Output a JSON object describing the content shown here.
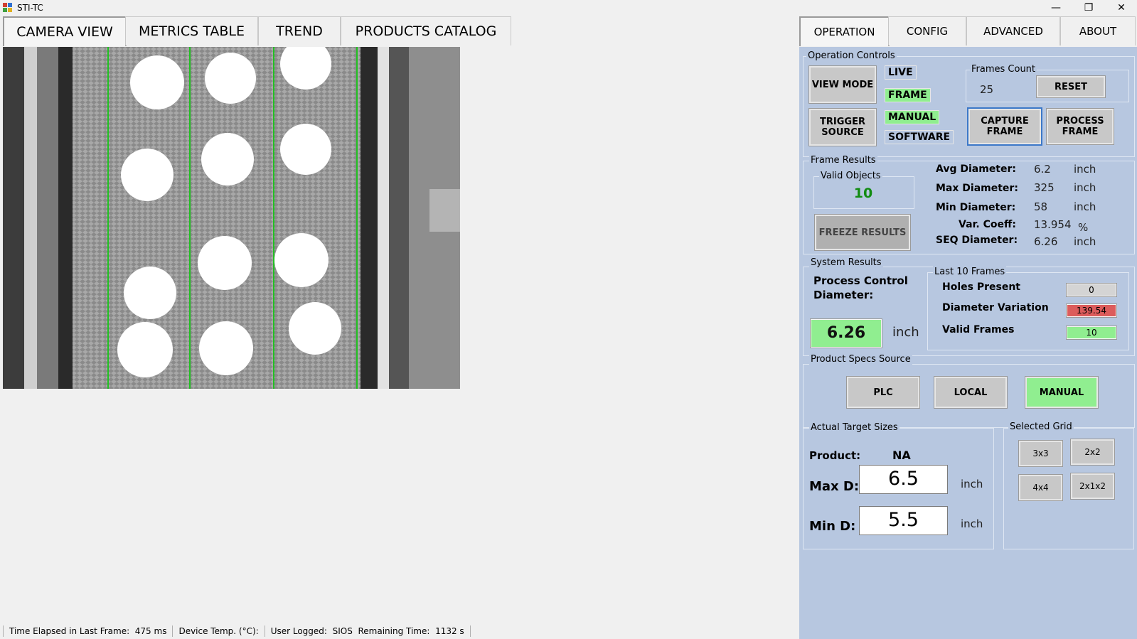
{
  "window": {
    "title": "STI-TC"
  },
  "left_tabs": [
    "CAMERA VIEW",
    "METRICS TABLE",
    "TREND",
    "PRODUCTS CATALOG"
  ],
  "right_tabs": [
    "OPERATION",
    "CONFIG",
    "ADVANCED",
    "ABOUT"
  ],
  "operation_controls": {
    "group_label": "Operation Controls",
    "view_mode_button": "VIEW MODE",
    "trigger_source_button": "TRIGGER SOURCE",
    "live_label": "LIVE",
    "frame_label": "FRAME",
    "manual_label": "MANUAL",
    "software_label": "SOFTWARE",
    "frames_count_label": "Frames Count",
    "frames_count_value": "25",
    "reset_button": "RESET",
    "capture_frame_button": "CAPTURE FRAME",
    "process_frame_button": "PROCESS FRAME"
  },
  "frame_results": {
    "group_label": "Frame Results",
    "valid_objects_label": "Valid Objects",
    "valid_objects_value": "10",
    "freeze_results_button": "FREEZE RESULTS",
    "metrics": [
      {
        "label": "Avg Diameter:",
        "value": "6.2",
        "unit": "inch"
      },
      {
        "label": "Max Diameter:",
        "value": "325",
        "unit": "inch"
      },
      {
        "label": "Min Diameter:",
        "value": "58",
        "unit": "inch"
      },
      {
        "label": "Var. Coeff:",
        "value": "13.954",
        "unit": "%"
      },
      {
        "label": "SEQ Diameter:",
        "value": "6.26",
        "unit": "inch"
      }
    ]
  },
  "system_results": {
    "group_label": "System Results",
    "process_control_label": "Process Control Diameter:",
    "process_control_value": "6.26",
    "process_control_unit": "inch",
    "last_frames_label": "Last 10 Frames",
    "rows": [
      {
        "label": "Holes Present",
        "value": "0",
        "color": "#d4d4d4"
      },
      {
        "label": "Diameter Variation",
        "value": "139.54",
        "color": "#dc5c5c"
      },
      {
        "label": "Valid Frames",
        "value": "10",
        "color": "#90ee90"
      }
    ]
  },
  "product_specs": {
    "group_label": "Product Specs Source",
    "buttons": [
      "PLC",
      "LOCAL",
      "MANUAL"
    ],
    "active": "MANUAL"
  },
  "target_sizes": {
    "group_label": "Actual Target Sizes",
    "product_label": "Product:",
    "product_value": "NA",
    "max_label": "Max D:",
    "max_value": "6.5",
    "min_label": "Min D:",
    "min_value": "5.5",
    "unit": "inch"
  },
  "selected_grid": {
    "group_label": "Selected Grid",
    "buttons": [
      "3x3",
      "2x2",
      "4x4",
      "2x1x2"
    ]
  },
  "status_bar": {
    "elapsed_label": "Time Elapsed in Last Frame:",
    "elapsed_value": "475 ms",
    "device_temp_label": "Device Temp. (°C):",
    "user_label": "User Logged:",
    "user_value": "SIOS",
    "remaining_label": "Remaining Time:",
    "remaining_value": "1132 s"
  },
  "colors": {
    "panel_bg": "#b7c7e0",
    "active_green": "#90ee90",
    "alert_red": "#dc5c5c",
    "guide_line_green": "#22c022"
  }
}
